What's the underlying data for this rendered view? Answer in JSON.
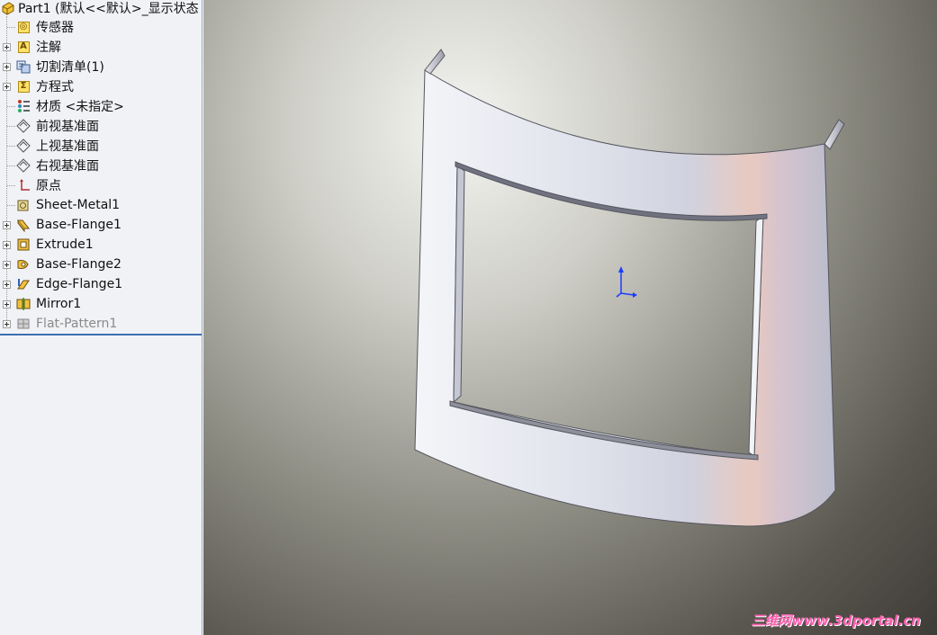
{
  "tree": {
    "root_label": "Part1 (默认<<默认>_显示状态",
    "items": [
      {
        "label": "传感器"
      },
      {
        "label": "注解"
      },
      {
        "label": "切割清单(1)"
      },
      {
        "label": "方程式"
      },
      {
        "label": "材质 <未指定>"
      },
      {
        "label": "前视基准面"
      },
      {
        "label": "上视基准面"
      },
      {
        "label": "右视基准面"
      },
      {
        "label": "原点"
      },
      {
        "label": "Sheet-Metal1"
      },
      {
        "label": "Base-Flange1"
      },
      {
        "label": "Extrude1"
      },
      {
        "label": "Base-Flange2"
      },
      {
        "label": "Edge-Flange1"
      },
      {
        "label": "Mirror1"
      },
      {
        "label": "Flat-Pattern1"
      }
    ]
  },
  "viewport": {
    "watermark": "三维网www.3dportal.cn"
  },
  "colors": {
    "accent": "#3f6fb0",
    "watermark": "#ff5fb0",
    "triad": "#1a3cff"
  }
}
